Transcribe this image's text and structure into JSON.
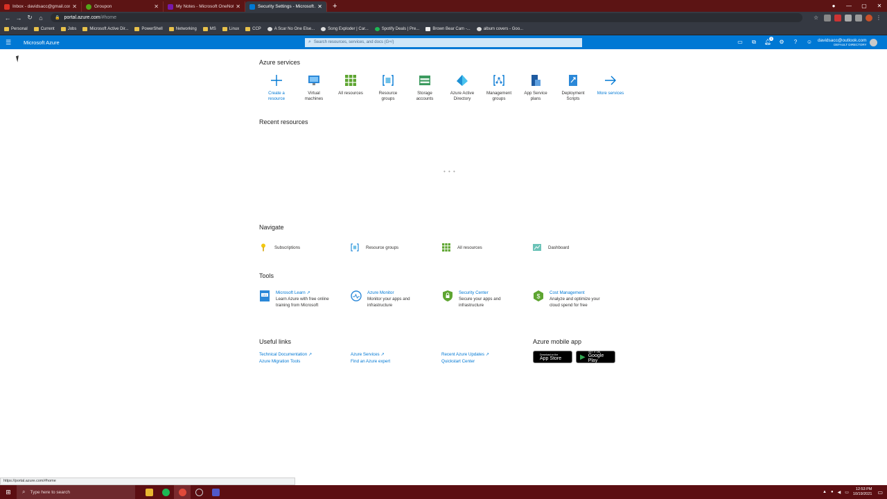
{
  "browser": {
    "tabs": [
      {
        "title": "Inbox - davidsacc@gmail.com - ...",
        "color": "#d93025",
        "active": false
      },
      {
        "title": "Groupon",
        "color": "#53a318",
        "active": false
      },
      {
        "title": "My Notes - Microsoft OneNote ...",
        "color": "#7719aa",
        "active": false
      },
      {
        "title": "Security Settings - Microsoft Az...",
        "color": "#0078d4",
        "active": true
      }
    ],
    "new_tab": "+",
    "url_host": "portal.azure.com",
    "url_path": "/#home",
    "bookmarks": [
      "Personal",
      "Current",
      "Jobs",
      "Microsoft Active Dir...",
      "PowerShell",
      "Networking",
      "MS",
      "Linux",
      "CCP",
      "A Scar No One Else...",
      "Song Exploder | Car...",
      "Spotify Deals | Pre...",
      "Brown Bear Cam -...",
      "album covers - Goo..."
    ],
    "status_url": "https://portal.azure.com/#home"
  },
  "azure": {
    "brand": "Microsoft Azure",
    "search_placeholder": "Search resources, services, and docs (G+/)",
    "notification_count": "1",
    "account_email": "davidsacc@outlook.com",
    "account_dir": "DEFAULT DIRECTORY"
  },
  "services": {
    "heading": "Azure services",
    "items": [
      {
        "l1": "Create a",
        "l2": "resource"
      },
      {
        "l1": "Virtual",
        "l2": "machines"
      },
      {
        "l1": "All resources",
        "l2": ""
      },
      {
        "l1": "Resource",
        "l2": "groups"
      },
      {
        "l1": "Storage",
        "l2": "accounts"
      },
      {
        "l1": "Azure Active",
        "l2": "Directory"
      },
      {
        "l1": "Management",
        "l2": "groups"
      },
      {
        "l1": "App Service",
        "l2": "plans"
      },
      {
        "l1": "Deployment",
        "l2": "Scripts"
      },
      {
        "l1": "More services",
        "l2": ""
      }
    ]
  },
  "recent": {
    "heading": "Recent resources",
    "loader": "• • •"
  },
  "navigate": {
    "heading": "Navigate",
    "items": [
      "Subscriptions",
      "Resource groups",
      "All resources",
      "Dashboard"
    ]
  },
  "tools": {
    "heading": "Tools",
    "items": [
      {
        "title": "Microsoft Learn ↗",
        "d1": "Learn Azure with free online",
        "d2": "training from Microsoft"
      },
      {
        "title": "Azure Monitor",
        "d1": "Monitor your apps and",
        "d2": "infrastructure"
      },
      {
        "title": "Security Center",
        "d1": "Secure your apps and",
        "d2": "infrastructure"
      },
      {
        "title": "Cost Management",
        "d1": "Analyze and optimize your",
        "d2": "cloud spend for free"
      }
    ]
  },
  "links": {
    "heading": "Useful links",
    "items": [
      "Technical Documentation ↗",
      "Azure Migration Tools",
      "Azure Services ↗",
      "Find an Azure expert",
      "Recent Azure Updates ↗",
      "Quickstart Center"
    ]
  },
  "mobile": {
    "heading": "Azure mobile app",
    "appstore_small": "Download on the",
    "appstore_big": "App Store",
    "play_small": "GET IT ON",
    "play_big": "Google Play"
  },
  "taskbar": {
    "search_placeholder": "Type here to search",
    "time": "12:53 PM",
    "date": "10/19/2021"
  }
}
